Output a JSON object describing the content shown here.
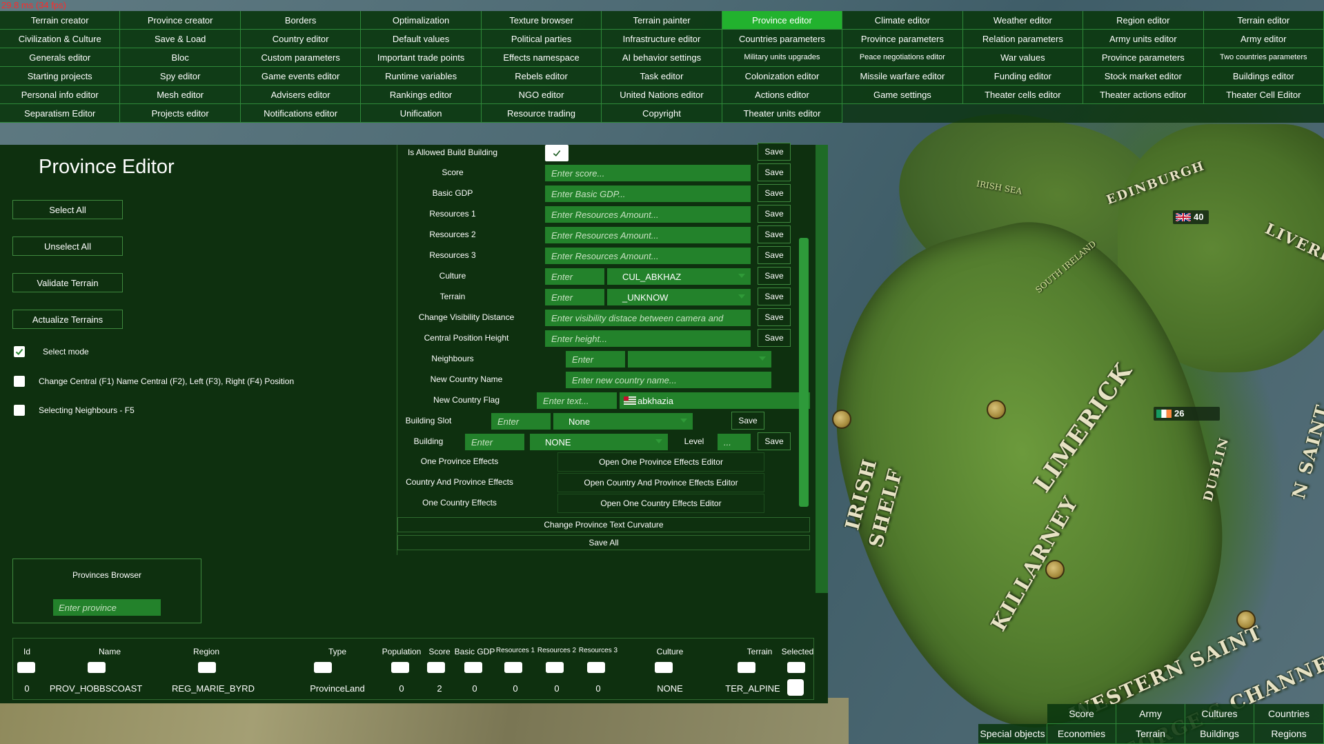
{
  "fps": "29.8 ms (34 fps)",
  "top_menu": [
    [
      "Terrain creator",
      "Province creator",
      "Borders",
      "Optimalization",
      "Texture browser",
      "Terrain painter",
      "Province editor",
      "Climate editor",
      "Weather editor",
      "Region editor",
      "Terrain editor"
    ],
    [
      "Civilization & Culture",
      "Save & Load",
      "Country editor",
      "Default values",
      "Political parties",
      "Infrastructure editor",
      "Countries parameters",
      "Province parameters",
      "Relation parameters",
      "Army units editor",
      "Army editor"
    ],
    [
      "Generals editor",
      "Bloc",
      "Custom parameters",
      "Important trade points",
      "Effects namespace",
      "AI behavior settings",
      "Military units upgrades",
      "Peace negotiations editor",
      "War values",
      "Province parameters",
      "Two countries parameters"
    ],
    [
      "Starting projects",
      "Spy editor",
      "Game events editor",
      "Runtime variables",
      "Rebels editor",
      "Task editor",
      "Colonization editor",
      "Missile warfare editor",
      "Funding editor",
      "Stock market editor",
      "Buildings editor"
    ],
    [
      "Personal info editor",
      "Mesh editor",
      "Advisers editor",
      "Rankings editor",
      "NGO editor",
      "United Nations editor",
      "Actions editor",
      "Game settings",
      "Theater cells editor",
      "Theater actions editor",
      "Theater Cell Editor"
    ],
    [
      "Separatism Editor",
      "Projects editor",
      "Notifications editor",
      "Unification",
      "Resource trading",
      "Copyright",
      "Theater units editor",
      "",
      "",
      "",
      ""
    ]
  ],
  "active_menu": "Province editor",
  "left": {
    "title": "Province Editor",
    "buttons": {
      "select_all": "Select All",
      "unselect_all": "Unselect All",
      "validate_terrain": "Validate Terrain",
      "actualize_terrains": "Actualize Terrains"
    },
    "checkboxes": {
      "select_mode": "Select mode",
      "change_central": "Change Central (F1) Name Central (F2), Left (F3), Right (F4) Position",
      "selecting_neighbours": "Selecting Neighbours - F5"
    },
    "browser": {
      "title": "Provinces Browser",
      "placeholder": "Enter province"
    }
  },
  "form": {
    "save": "Save",
    "is_allowed_build_building": "Is Allowed Build Building",
    "score": {
      "label": "Score",
      "placeholder": "Enter score..."
    },
    "basic_gdp": {
      "label": "Basic GDP",
      "placeholder": "Enter Basic GDP..."
    },
    "resources1": {
      "label": "Resources 1",
      "placeholder": "Enter Resources Amount..."
    },
    "resources2": {
      "label": "Resources 2",
      "placeholder": "Enter Resources Amount..."
    },
    "resources3": {
      "label": "Resources 3",
      "placeholder": "Enter Resources Amount..."
    },
    "culture": {
      "label": "Culture",
      "placeholder": "Enter",
      "value": "CUL_ABKHAZ"
    },
    "terrain": {
      "label": "Terrain",
      "placeholder": "Enter",
      "value": "_UNKNOW"
    },
    "visibility": {
      "label": "Change Visibility Distance",
      "placeholder": "Enter visibility distace between camera and"
    },
    "central_height": {
      "label": "Central Position Height",
      "placeholder": "Enter height..."
    },
    "neighbours": {
      "label": "Neighbours",
      "placeholder": "Enter"
    },
    "new_country_name": {
      "label": "New Country Name",
      "placeholder": "Enter new country name..."
    },
    "new_country_flag": {
      "label": "New Country Flag",
      "placeholder": "Enter text...",
      "value": "abkhazia"
    },
    "building_slot": {
      "label": "Building Slot",
      "placeholder": "Enter",
      "value": "None"
    },
    "building": {
      "label": "Building",
      "placeholder": "Enter",
      "value": "NONE",
      "level_label": "Level",
      "level_placeholder": "..."
    },
    "one_province_effects": {
      "label": "One Province Effects",
      "button": "Open One Province Effects Editor"
    },
    "country_province_effects": {
      "label": "Country And Province Effects",
      "button": "Open Country And Province Effects Editor"
    },
    "one_country_effects": {
      "label": "One Country Effects",
      "button": "Open One Country Effects Editor"
    },
    "change_curvature": "Change Province Text Curvature",
    "save_all": "Save All"
  },
  "table": {
    "headers": [
      "Id",
      "Name",
      "Region",
      "Type",
      "Population",
      "Score",
      "Basic GDP",
      "Resources 1",
      "Resources 2",
      "Resources 3",
      "Culture",
      "Terrain",
      "Selected"
    ],
    "rows": [
      [
        "0",
        "PROV_HOBBSCOAST",
        "REG_MARIE_BYRD",
        "ProvinceLand",
        "0",
        "2",
        "0",
        "0",
        "0",
        "0",
        "NONE",
        "TER_ALPINE"
      ]
    ]
  },
  "map": {
    "labels": [
      "LIMERICK",
      "KILLARNEY",
      "DUBLIN",
      "WESTERN SAINT",
      "GEORGE'S CHANNEL",
      "EDINBURGH",
      "LIVERP",
      "IRISH",
      "SHELF",
      "N SAINT",
      "SOUTH IRELAND",
      "IRISH SEA"
    ],
    "unit_badges": [
      {
        "value": "40",
        "flag": "uk"
      },
      {
        "value": "26",
        "flag": "ireland"
      }
    ],
    "colors": {
      "ireland_flag": [
        "#169b62",
        "#ffffff",
        "#ff883e"
      ],
      "uk_flag": [
        "#012169",
        "#c8102e",
        "#ffffff"
      ]
    }
  },
  "map_tabs": {
    "row1": [
      "",
      "Score",
      "Army",
      "Cultures",
      "Countries"
    ],
    "row2": [
      "Special objects",
      "Economies",
      "Terrain",
      "Buildings",
      "Regions"
    ]
  },
  "colors": {
    "panel_bg": "#0e300f",
    "input_bg": "#23822b",
    "active_menu": "#22b22e",
    "border": "#3f8a3f"
  }
}
